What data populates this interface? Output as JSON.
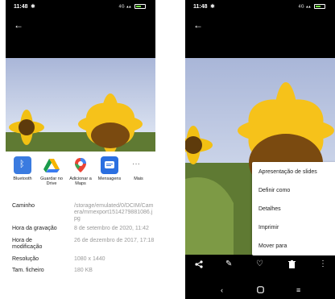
{
  "status": {
    "time": "11:48",
    "network": "4G"
  },
  "share": {
    "items": [
      {
        "label": "Bluetooth"
      },
      {
        "label": "Guardar no Drive"
      },
      {
        "label": "Adicionar a Maps"
      },
      {
        "label": "Mensagens"
      },
      {
        "label": "Mais"
      }
    ]
  },
  "details": {
    "rows": [
      {
        "key": "Caminho",
        "value": "/storage/emulated/0/DCIM/Camera/mmexport1514279881086.jpg"
      },
      {
        "key": "Hora da gravação",
        "value": "8 de setembro de 2020, 11:42"
      },
      {
        "key": "Hora de modificação",
        "value": "26 de dezembro de 2017, 17:18"
      },
      {
        "key": "Resolução",
        "value": "1080 x 1440"
      },
      {
        "key": "Tam. ficheiro",
        "value": "180 KB"
      }
    ]
  },
  "menu": {
    "items": [
      {
        "label": "Apresentação de slides"
      },
      {
        "label": "Definir como"
      },
      {
        "label": "Detalhes"
      },
      {
        "label": "Imprimir"
      },
      {
        "label": "Mover para"
      }
    ]
  },
  "colors": {
    "bluetooth": "#3a7be0",
    "messages": "#2b6fe0",
    "battery": "#6bdc3a"
  },
  "icons": {
    "toolbar": [
      "share-icon",
      "edit-icon",
      "heart-icon",
      "trash-icon",
      "more-vert-icon"
    ],
    "navbar": [
      "nav-back-icon",
      "nav-home-icon",
      "nav-menu-icon"
    ]
  }
}
